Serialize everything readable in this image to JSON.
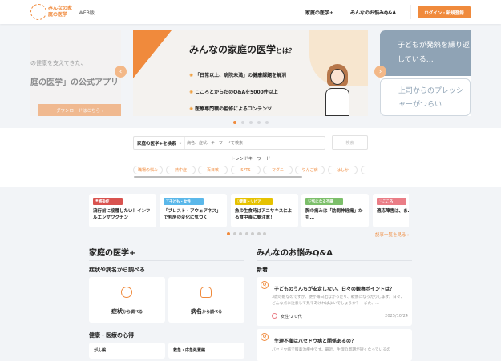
{
  "header": {
    "logo_text": "みんなの家庭の医学",
    "web_label": "WEB版",
    "nav": [
      "家庭の医学+",
      "みんなのお悩みQ&A"
    ],
    "login_button": "ログイン・新規登録",
    "accent": "#f08a3c"
  },
  "carousel": {
    "left_slide": {
      "line1": "の健康を支えてきた、",
      "line2": "庭の医学」の公式アプリ",
      "button": "ダウンロードはこちら ›"
    },
    "main_slide": {
      "title": "みんなの家庭の医学",
      "title_suffix": "とは？",
      "points": [
        "「日常以上、病院未満」の健康課題を解消",
        "こころとからだのQ&Aを5000件以上",
        "医療専門職の監修によるコンテンツ"
      ]
    },
    "right_slide": {
      "bubble1": "子どもが発熱を繰り返している…",
      "bubble2": "上司からのプレッシャーがつらい"
    },
    "dots": 5,
    "active_dot": 0
  },
  "search": {
    "scope": "家庭の医学+を検索",
    "placeholder": "病名、症状、キーワードで検索",
    "button": "検索",
    "trend_label": "トレンドキーワード",
    "keywords": [
      "職場の悩み",
      "熱中症",
      "百日咳",
      "SFTS",
      "マダニ",
      "りんご病",
      "はしか"
    ]
  },
  "articles": {
    "cards": [
      {
        "tag": "感染症",
        "color": "#d9534f",
        "icon": "virus-icon",
        "title": "流行前に接種したい！インフルエンザワクチン"
      },
      {
        "tag": "子ども・女性",
        "color": "#5bb8ea",
        "icon": "shirt-icon",
        "title": "「ブレスト・アウェアネス」で乳房の変化に気づく"
      },
      {
        "tag": "健康トリビア",
        "color": "#e6c200",
        "icon": "book-icon",
        "title": "魚の生食時はアニサキスによる食中毒に要注意！"
      },
      {
        "tag": "気になる不調",
        "color": "#7cbf6a",
        "icon": "face-icon",
        "title": "胸の痛みは「肋間神経痛」かも…"
      },
      {
        "tag": "こころ",
        "color": "#ea7d86",
        "icon": "heart-icon",
        "title": "適応障害は、ま…から"
      }
    ],
    "dots": 7,
    "active_dot": 0,
    "see_all": "記事一覧を見る ›"
  },
  "left_col": {
    "title": "家庭の医学+",
    "search_heading": "症状や病名から調べる",
    "buttons": [
      {
        "main": "症状",
        "suffix": "から調べる",
        "icon": "child-face-icon"
      },
      {
        "main": "病名",
        "suffix": "から調べる",
        "icon": "lungs-icon"
      }
    ],
    "health_heading": "健康・医療の心得",
    "health_items": [
      "がん編",
      "救急・応急処置編"
    ]
  },
  "right_col": {
    "title": "みんなのお悩みQ&A",
    "new_heading": "新着",
    "questions": [
      {
        "title": "子どものうんちが安定しない。日々の観察ポイントは？",
        "body": "3歳の娘なのですが、便が毎日出なかったり、軟便になったりします。日々、どんな点に注意して見てあげればよいでしょうか？　また、…",
        "user": "女性/２０代",
        "date": "2025/10/24"
      },
      {
        "title": "生理不順はバセドウ病と関係あるの？",
        "body": "バセドウ病で服薬治療中です。最近、生理の周期が短くなっているの"
      }
    ]
  }
}
